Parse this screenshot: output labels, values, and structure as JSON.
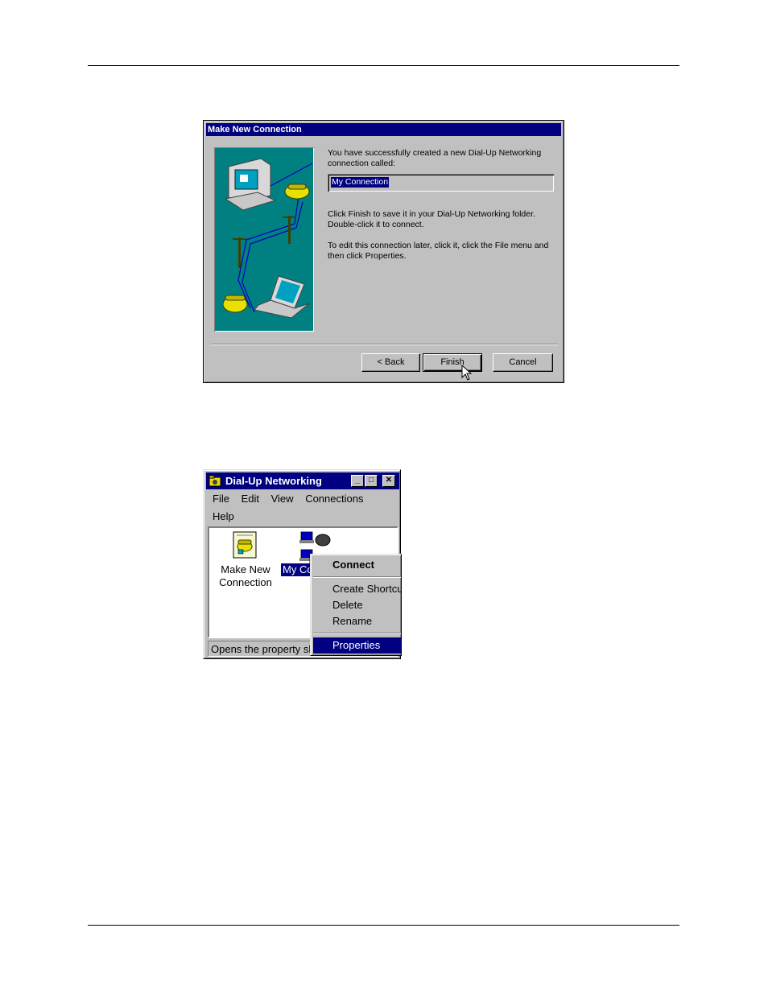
{
  "wizard": {
    "title": "Make New Connection",
    "message_1": "You have successfully created a new Dial-Up Networking connection called:",
    "connection_name": "My Connection",
    "message_2": "Click Finish to save it in your Dial-Up Networking folder. Double-click it to connect.",
    "message_3": "To edit this connection later, click it, click the File menu and then click Properties.",
    "buttons": {
      "back": "< Back",
      "finish": "Finish",
      "cancel": "Cancel"
    }
  },
  "dun_window": {
    "title": "Dial-Up Networking",
    "controls": {
      "minimize": "_",
      "maximize": "□",
      "close": "✕"
    },
    "menu": [
      "File",
      "Edit",
      "View",
      "Connections",
      "Help"
    ],
    "icons": [
      {
        "label_line1": "Make New",
        "label_line2": "Connection",
        "icon": "make-new-connection-icon"
      },
      {
        "label": "My Co",
        "icon": "connection-icon",
        "selected": true
      }
    ],
    "status": "Opens the property sh"
  },
  "context_menu": {
    "items": [
      "Connect",
      "Create Shortcut",
      "Delete",
      "Rename",
      "Properties"
    ],
    "default_item": "Connect",
    "highlighted_item": "Properties"
  },
  "colors": {
    "titlebar": "#000080",
    "face": "#c0c0c0",
    "wizard_art_bg": "#008080",
    "highlight": "#000080"
  }
}
